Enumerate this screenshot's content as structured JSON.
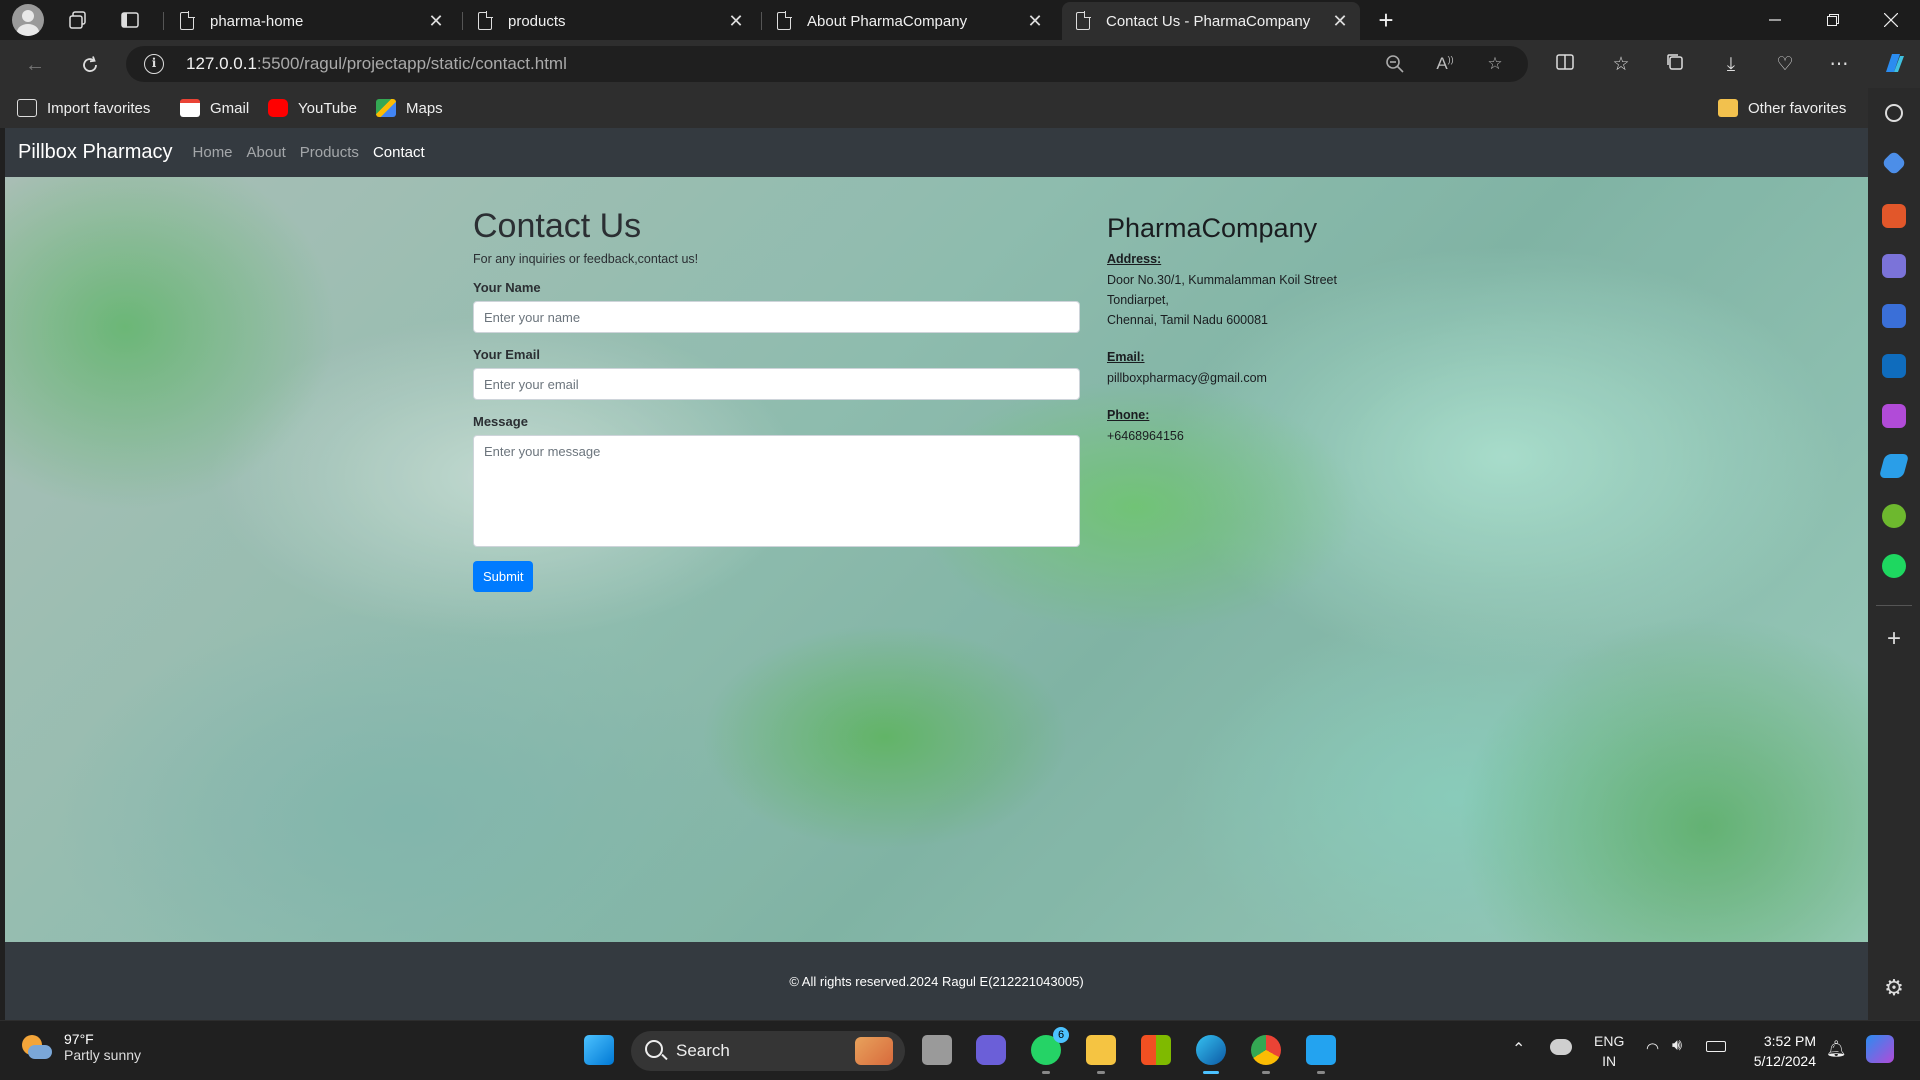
{
  "browser": {
    "tabs": [
      {
        "title": "pharma-home"
      },
      {
        "title": "products"
      },
      {
        "title": "About PharmaCompany"
      },
      {
        "title": "Contact Us - PharmaCompany"
      }
    ],
    "new_tab_label": "+",
    "url_host": "127.0.0.1",
    "url_rest": ":5500/ragul/projectapp/static/contact.html",
    "favorites": [
      {
        "label": "Import favorites"
      },
      {
        "label": "Gmail"
      },
      {
        "label": "YouTube"
      },
      {
        "label": "Maps"
      }
    ],
    "other_favorites": "Other favorites"
  },
  "site": {
    "brand": "Pillbox Pharmacy",
    "nav": [
      "Home",
      "About",
      "Products",
      "Contact"
    ],
    "active_nav": "Contact",
    "contact": {
      "title": "Contact Us",
      "lead": "For any inquiries or feedback,contact us!",
      "name_label": "Your Name",
      "name_placeholder": "Enter your name",
      "email_label": "Your Email",
      "email_placeholder": "Enter your email",
      "message_label": "Message",
      "message_placeholder": "Enter your message",
      "submit": "Submit"
    },
    "company": {
      "name": "PharmaCompany",
      "address_label": "Address:",
      "address_lines": [
        "Door No.30/1, Kummalamman Koil Street",
        "Tondiarpet,",
        "Chennai, Tamil Nadu 600081"
      ],
      "email_label": "Email:",
      "email": "pillboxpharmacy@gmail.com",
      "phone_label": "Phone:",
      "phone": "+6468964156"
    },
    "footer": "© All rights reserved.2024 Ragul E(212221043005)"
  },
  "taskbar": {
    "weather_temp": "97°F",
    "weather_desc": "Partly sunny",
    "search_label": "Search",
    "whatsapp_badge": "6",
    "lang_top": "ENG",
    "lang_bottom": "IN",
    "time": "3:52 PM",
    "date": "5/12/2024"
  },
  "colors": {
    "navbar": "#343a40",
    "primary_button": "#007bff",
    "browser_chrome": "#2e2e2e"
  }
}
